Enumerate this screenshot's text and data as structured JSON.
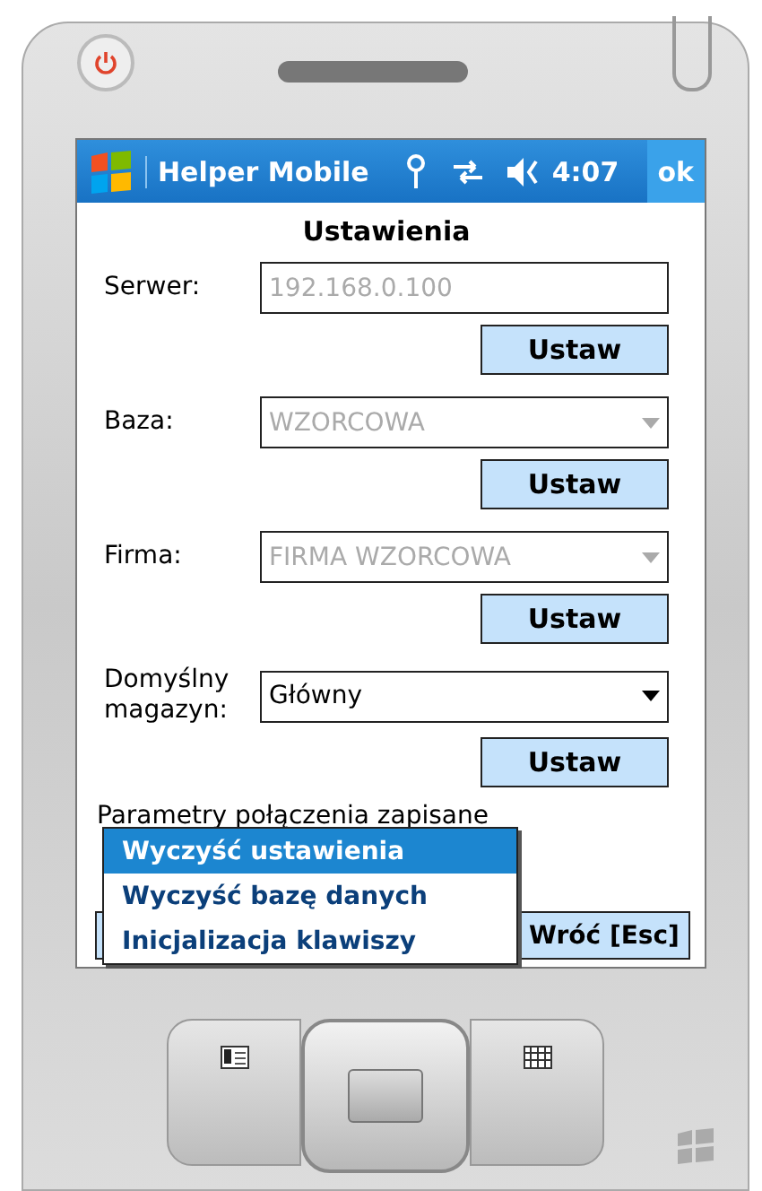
{
  "title_bar": {
    "title": "Helper Mobile",
    "time": "4:07",
    "ok": "ok"
  },
  "heading": "Ustawienia",
  "fields": [
    {
      "label": "Serwer:",
      "kind": "text",
      "value": "192.168.0.100",
      "disabled": true,
      "button": "Ustaw"
    },
    {
      "label": "Baza:",
      "kind": "dropdown",
      "value": "WZORCOWA",
      "disabled": true,
      "button": "Ustaw"
    },
    {
      "label": "Firma:",
      "kind": "dropdown",
      "value": "FIRMA WZORCOWA",
      "disabled": true,
      "button": "Ustaw"
    },
    {
      "label": "Domyślny magazyn:",
      "kind": "dropdown",
      "value": "Główny",
      "disabled": false,
      "button": "Ustaw"
    }
  ],
  "status": "Parametry połączenia zapisane",
  "menu": [
    {
      "label": "Wyczyść ustawienia",
      "selected": true
    },
    {
      "label": "Wyczyść bazę danych",
      "selected": false
    },
    {
      "label": "Inicjalizacja klawiszy",
      "selected": false
    }
  ],
  "softkeys": {
    "right": "Wróć [Esc]"
  }
}
